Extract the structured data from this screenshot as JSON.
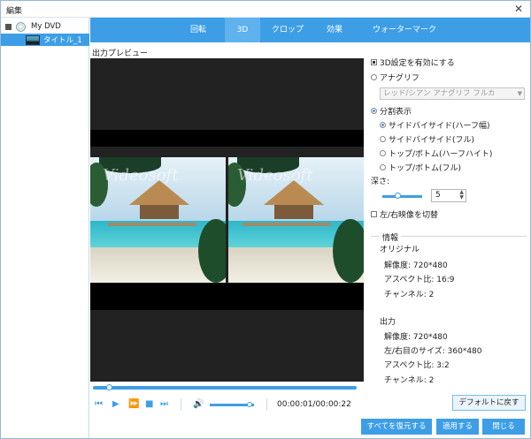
{
  "window": {
    "title": "編集",
    "close_glyph": "✕"
  },
  "tree": {
    "root_label": "My DVD",
    "child_label": "タイトル_1"
  },
  "tabs": [
    {
      "label": "回転"
    },
    {
      "label": "3D"
    },
    {
      "label": "クロップ"
    },
    {
      "label": "効果"
    },
    {
      "label": "ウォーターマーク"
    }
  ],
  "active_tab": "3D",
  "preview": {
    "label": "出力プレビュー",
    "watermark": "Videosoft",
    "progress": 0.06,
    "timecode": "00:00:01/00:00:22",
    "volume": 0.9
  },
  "settings": {
    "enable_3d": "3D設定を有効にする",
    "anaglyph": "アナグリフ",
    "anaglyph_select": "レッド/シアン アナグリフ フルカ",
    "split": "分割表示",
    "split_options": [
      "サイドバイサイド(ハーフ幅)",
      "サイドバイサイド(フル)",
      "トップ/ボトム(ハーフハイト)",
      "トップ/ボトム(フル)"
    ],
    "depth_label": "深さ:",
    "depth_value": "5",
    "swap": "左/右映像を切替"
  },
  "info": {
    "title": "情報",
    "original_title": "オリジナル",
    "original": [
      "解像度: 720*480",
      "アスペクト比: 16:9",
      "チャンネル: 2"
    ],
    "output_title": "出力",
    "output": [
      "解像度: 720*480",
      "左/右目のサイズ: 360*480",
      "アスペクト比: 3:2",
      "チャンネル: 2"
    ]
  },
  "buttons": {
    "default": "デフォルトに戻す",
    "restore_all": "すべてを復元する",
    "apply": "適用する",
    "close": "閉じる"
  },
  "colors": {
    "accent": "#3d9ee6"
  }
}
